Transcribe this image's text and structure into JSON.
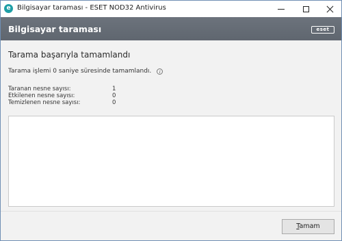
{
  "window": {
    "title": "Bilgisayar taraması - ESET NOD32 Antivirus",
    "app_icon_letter": "e",
    "icons": {
      "app": "eset-app-icon",
      "minimize": "minimize-icon",
      "maximize": "maximize-icon",
      "close": "close-icon"
    }
  },
  "header": {
    "title": "Bilgisayar taraması",
    "logo_text": "eset"
  },
  "main": {
    "heading": "Tarama başarıyla tamamlandı",
    "summary": "Tarama işlemi 0 saniye süresinde tamamlandı.",
    "stats": [
      {
        "label": "Taranan nesne sayısı:",
        "value": "1"
      },
      {
        "label": "Etkilenen nesne sayısı:",
        "value": "0"
      },
      {
        "label": "Temizlenen nesne sayısı:",
        "value": "0"
      }
    ]
  },
  "footer": {
    "ok_mnemonic": "T",
    "ok_rest": "amam"
  },
  "colors": {
    "header_bg": "#5f666f",
    "content_bg": "#f2f2f2",
    "app_icon": "#1f9fa6"
  }
}
